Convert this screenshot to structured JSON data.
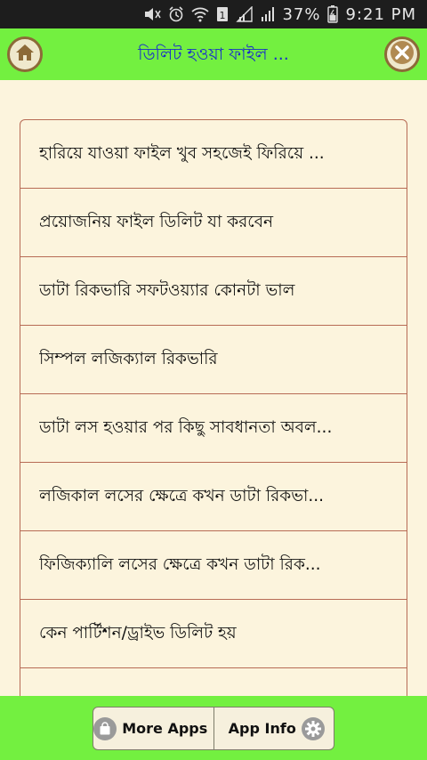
{
  "status_bar": {
    "battery": "37%",
    "time": "9:21 PM"
  },
  "app_bar": {
    "title": "ডিলিট হওয়া ফাইল ..."
  },
  "list": {
    "items": [
      "হারিয়ে যাওয়া ফাইল খুব সহজেই ফিরিয়ে ...",
      "প্রয়োজনিয় ফাইল ডিলিট যা করবেন",
      "ডাটা রিকভারি সফটওয়্যার কোনটা ভাল",
      "সিম্পল লজিক্যাল রিকভারি",
      "ডাটা লস হওয়ার পর কিছু সাবধানতা অবল...",
      "লজিকাল লসের ক্ষেত্রে কখন ডাটা রিকভা...",
      "ফিজিক্যালি লসের ক্ষেত্রে কখন ডাটা রিক...",
      "কেন পার্টিশন/ড্রাইভ ডিলিট হয়",
      ""
    ]
  },
  "bottom_bar": {
    "more_apps_label": "More Apps",
    "app_info_label": "App Info"
  },
  "colors": {
    "accent_green": "#73f040",
    "title_blue": "#1a2ec9",
    "row_border": "#b76b55",
    "background": "#fcf4dd"
  },
  "icons": {
    "home": "home-icon",
    "close": "close-icon",
    "more_apps": "bag-icon",
    "app_info": "gear-icon"
  }
}
